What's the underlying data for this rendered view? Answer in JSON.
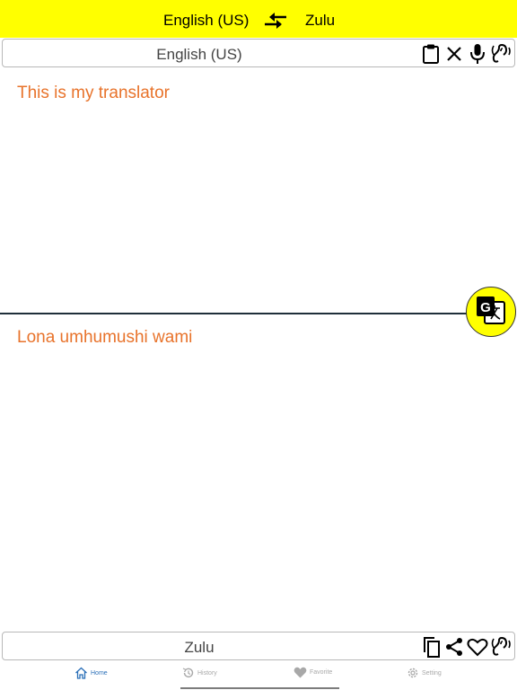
{
  "header": {
    "source_language": "English (US)",
    "target_language": "Zulu",
    "swap_icon": "swap-arrows-icon"
  },
  "input_panel": {
    "language_label": "English (US)",
    "text": "This is my translator",
    "icons": [
      "clipboard-icon",
      "clear-x-icon",
      "microphone-icon",
      "speaker-ear-icon"
    ]
  },
  "translate_button": {
    "icon": "google-translate-icon"
  },
  "output_panel": {
    "text": "Lona umhumushi wami",
    "language_label": "Zulu",
    "icons": [
      "copy-icon",
      "share-icon",
      "favorite-heart-icon",
      "speaker-ear-icon"
    ]
  },
  "tabs": [
    {
      "label": "Home",
      "icon": "home-icon",
      "active": true
    },
    {
      "label": "History",
      "icon": "history-icon",
      "active": false
    },
    {
      "label": "Favorite",
      "icon": "heart-icon",
      "active": false
    },
    {
      "label": "Setting",
      "icon": "gear-icon",
      "active": false
    }
  ],
  "colors": {
    "accent_yellow": "#ffff00",
    "text_orange": "#e8732b",
    "tab_active": "#2a6fb8",
    "tab_inactive": "#a8a8a8"
  }
}
